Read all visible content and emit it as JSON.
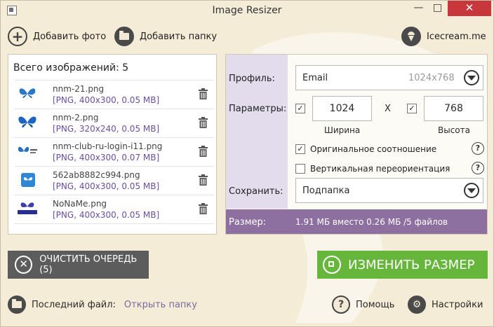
{
  "window": {
    "title": "Image Resizer",
    "minimize": "—",
    "maximize": "□",
    "close": "✕"
  },
  "toolbar": {
    "add_photo": "Добавить фото",
    "add_folder": "Добавить папку",
    "brand": "Icecream.me"
  },
  "queue": {
    "count_label": "Всего изображений: 5",
    "files": [
      {
        "name": "nnm-21.png",
        "info": "[PNG, 400x300, 0.05 MB]"
      },
      {
        "name": "nnm-2.png",
        "info": "[PNG, 320x240, 0.05 MB]"
      },
      {
        "name": "nnm-club-ru-login-i11.png",
        "info": "[PNG, 400x300, 0.07 MB]"
      },
      {
        "name": "562ab8882c994.png",
        "info": "[PNG, 400x300, 0.05 MB]"
      },
      {
        "name": "NoNaMe.png",
        "info": "[PNG, 400x300, 0.05 MB]"
      }
    ]
  },
  "settings": {
    "profile_label": "Профиль:",
    "profile_value": "Email",
    "profile_size": "1024x768",
    "params_label": "Параметры:",
    "width_value": "1024",
    "height_value": "768",
    "x_sep": "X",
    "width_label": "Ширина",
    "height_label": "Высота",
    "keep_ratio_label": "Оригинальное соотношение",
    "vertical_label": "Вертикальная переориентация",
    "save_label": "Сохранить:",
    "save_value": "Подпапка",
    "help": "?",
    "check": "✓"
  },
  "size_bar": {
    "label": "Размер:",
    "value": "1.91 МБ вместо 0.26 МБ /5 файлов"
  },
  "actions": {
    "clear": "ОЧИСТИТЬ ОЧЕРЕДЬ (5)",
    "resize": "ИЗМЕНИТЬ РАЗМЕР"
  },
  "footer": {
    "last_file": "Последний файл:",
    "open_folder": "Открыть папку",
    "help": "Помощь",
    "settings": "Настройки"
  },
  "colors": {
    "accent_green": "#66b63b",
    "accent_purple": "#8d6fa0",
    "dark_button": "#5c5c5c",
    "close_red": "#c7373b",
    "link_purple": "#6b4ea1"
  }
}
